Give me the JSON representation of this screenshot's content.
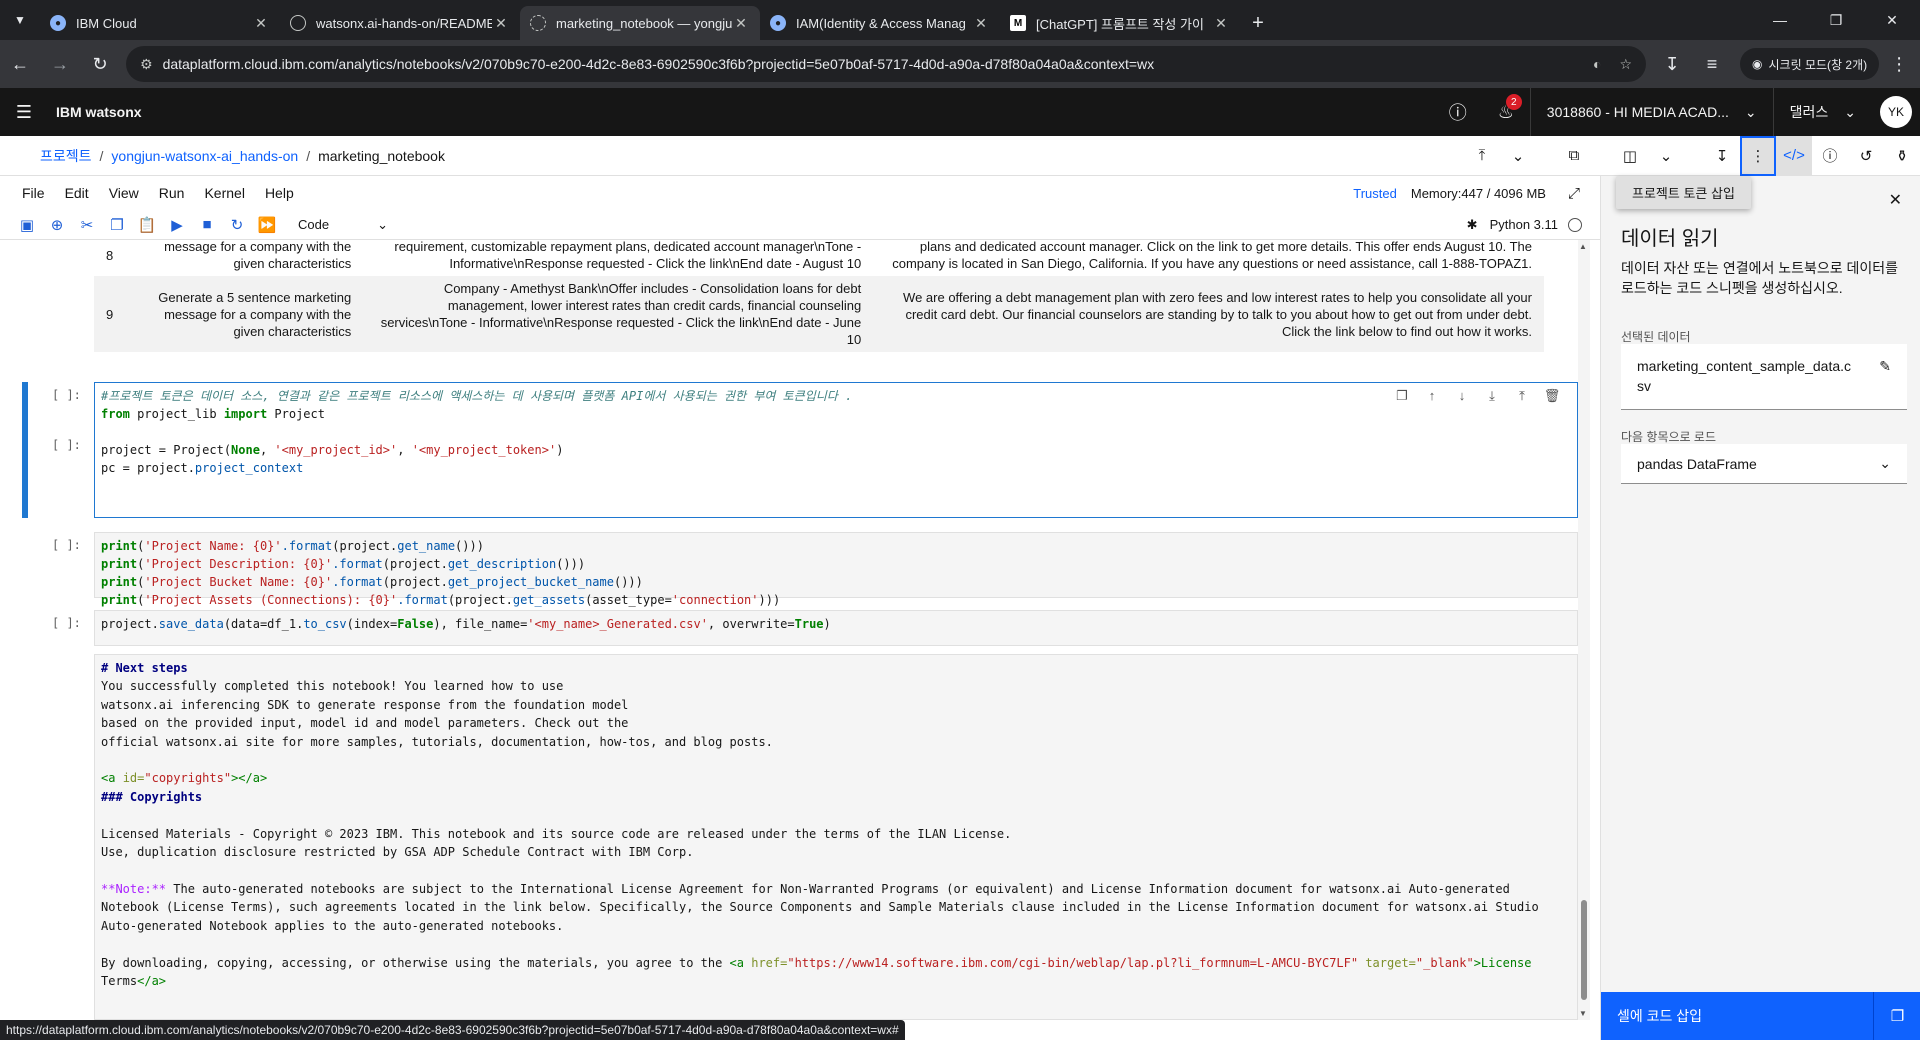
{
  "browser": {
    "tabs": [
      {
        "title": "IBM Cloud",
        "icon": "globe-icon",
        "active": false
      },
      {
        "title": "watsonx.ai-hands-on/README",
        "icon": "github-icon",
        "active": false
      },
      {
        "title": "marketing_notebook — yongju",
        "icon": "watsonx-icon",
        "active": true
      },
      {
        "title": "IAM(Identity & Access Manag",
        "icon": "globe-icon",
        "active": false
      },
      {
        "title": "[ChatGPT] 프롬프트 작성 가이",
        "icon": "medium-icon",
        "active": false
      }
    ],
    "url": "dataplatform.cloud.ibm.com/analytics/notebooks/v2/070b9c70-e200-4d2c-8e83-6902590c3f6b?projectid=5e07b0af-5717-4d0d-a90a-d78f80a04a0a&context=wx",
    "incognito": "시크릿 모드(창 2개)"
  },
  "header": {
    "brand": "IBM watsonx",
    "notifications": "2",
    "account": "3018860 - HI MEDIA ACAD...",
    "region": "댈러스",
    "avatar": "YK"
  },
  "breadcrumb": {
    "root": "프로젝트",
    "project": "yongjun-watsonx-ai_hands-on",
    "current": "marketing_notebook"
  },
  "menu": {
    "items": [
      "File",
      "Edit",
      "View",
      "Run",
      "Kernel",
      "Help"
    ],
    "trusted": "Trusted",
    "memory": "Memory:447 / 4096 MB"
  },
  "toolbar": {
    "cell_type": "Code",
    "kernel": "Python 3.11"
  },
  "output_table": [
    {
      "idx": "8",
      "c1": "message for a company with the given characteristics",
      "c2": "requirement, customizable repayment plans, dedicated account manager\\nTone - Informative\\nResponse requested - Click the link\\nEnd date - August 10",
      "c3": "plans and dedicated account manager. Click on the link to get more details. This offer ends August 10. The company is located in San Diego, California. If you have any questions or need assistance, call 1-888-TOPAZ1."
    },
    {
      "idx": "9",
      "c1": "Generate a 5 sentence marketing message for a company with the given characteristics",
      "c2": "Company - Amethyst Bank\\nOffer includes - Consolidation loans for debt management, lower interest rates than credit cards, financial counseling services\\nTone - Informative\\nResponse requested - Click the link\\nEnd date - June 10",
      "c3": "We are offering a debt management plan with zero fees and low interest rates to help you consolidate all your credit card debt. Our financial counselors are standing by to talk to you about how to get out from under debt. Click the link below to find out how it works."
    }
  ],
  "cells": {
    "prompt": "[ ]:",
    "c1": {
      "comment": "#프로젝트 토큰은 데이터 소스, 연결과 같은 프로젝트 리소스에 액세스하는 데 사용되며 플랫폼 API에서 사용되는 권한 부여 토큰입니다 .",
      "l2a": "from",
      "l2b": " project_lib ",
      "l2c": "import",
      "l2d": " Project",
      "l4a": "project = Project(",
      "l4b": "None",
      "l4c": ", ",
      "l4d": "'<my_project_id>'",
      "l4e": ", ",
      "l4f": "'<my_project_token>'",
      "l4g": ")",
      "l5a": "pc = project.",
      "l5b": "project_context"
    },
    "c2": {
      "p": "print",
      "op": "(",
      "s1": "'Project Name: {0}'",
      "s2": "'Project Description: {0}'",
      "s3": "'Project Bucket Name: {0}'",
      "s4": "'Project Assets (Connections): {0}'",
      "fmt": ".format",
      "mid": "(project.",
      "f1": "get_name",
      "f2": "get_description",
      "f3": "get_project_bucket_name",
      "f4": "get_assets",
      "e1": "()))",
      "e4a": "(asset_type=",
      "e4b": "'connection'",
      "e4c": ")))"
    },
    "c3": {
      "a": "project.",
      "b": "save_data",
      "c": "(data=df_1.",
      "d": "to_csv",
      "e": "(index=",
      "f": "False",
      "g": "), file_name=",
      "h": "'<my_name>_Generated.csv'",
      "i": ", overwrite=",
      "j": "True",
      "k": ")"
    },
    "md": {
      "h1": "# Next steps",
      "l1": "You successfully completed this notebook! You learned how to use",
      "l2": "watsonx.ai inferencing SDK to generate response from the foundation model",
      "l3": "based on the provided input, model id and model parameters. Check out the",
      "l4": "official watsonx.ai site for more samples, tutorials, documentation, how-tos, and blog posts.",
      "a1": "<a ",
      "a2": "id=",
      "a3": "\"copyrights\"",
      "a4": "></a>",
      "h3": "### Copyrights",
      "lic1": "Licensed Materials - Copyright © 2023 IBM. This notebook and its source code are released under the terms of the ILAN License.",
      "lic2": "Use, duplication disclosure restricted by GSA ADP Schedule Contract with IBM Corp.",
      "n1": "**Note:**",
      "n2": " The auto-generated notebooks are subject to the International License Agreement for Non-Warranted Programs (or equivalent) and License Information document for watsonx.ai Auto-generated",
      "n3": "Notebook (License Terms), such agreements located in the link below. Specifically, the Source Components and Sample Materials clause included in the License Information document for watsonx.ai Studio",
      "n4": "Auto-generated Notebook applies to the auto-generated notebooks.",
      "b1": "By downloading, copying, accessing, or otherwise using the materials, you agree to the ",
      "b2": "<a ",
      "b3": "href=",
      "b4": "\"https://www14.software.ibm.com/cgi-bin/weblap/lap.pl?li_formnum=L-AMCU-BYC7LF\"",
      "b5": " target=",
      "b6": "\"_blank\"",
      "b7": ">License",
      "b8": "Terms",
      "b9": "</a>"
    }
  },
  "panel": {
    "tooltip": "프로젝트 토큰 삽입",
    "title": "데이터 읽기",
    "desc": "데이터 자산 또는 연결에서 노트북으로 데이터를 로드하는 코드 스니펫을 생성하십시오.",
    "selected_label": "선택된 데이터",
    "selected_file": "marketing_content_sample_data.csv",
    "load_label": "다음 항목으로 로드",
    "load_value": "pandas DataFrame",
    "insert_button": "셀에 코드 삽입"
  },
  "status_url": "https://dataplatform.cloud.ibm.com/analytics/notebooks/v2/070b9c70-e200-4d2c-8e83-6902590c3f6b?projectid=5e07b0af-5717-4d0d-a90a-d78f80a04a0a&context=wx#"
}
